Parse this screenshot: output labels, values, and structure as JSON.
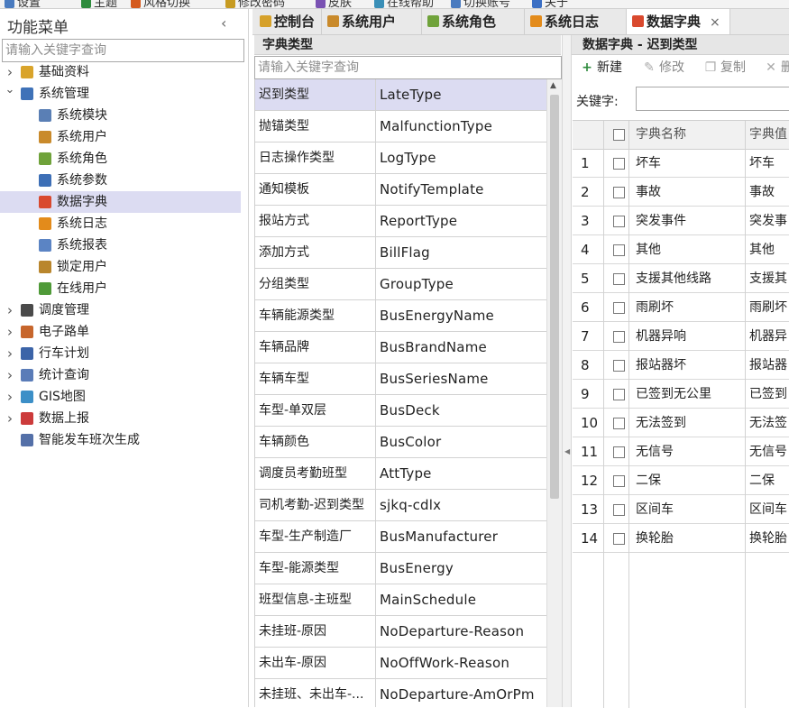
{
  "topbar": {
    "items": [
      "设置",
      "主题",
      "风格切换",
      "修改密码",
      "皮肤",
      "在线帮助",
      "切换账号",
      "关于"
    ]
  },
  "sidebar": {
    "title": "功能菜单",
    "collapse_glyph": "‹",
    "search_placeholder": "请输入关键字查询",
    "items": [
      {
        "label": "基础资料",
        "level": 0,
        "expanded": false,
        "icon": "box-icon"
      },
      {
        "label": "系统管理",
        "level": 0,
        "expanded": true,
        "icon": "tools-icon"
      },
      {
        "label": "系统模块",
        "level": 1,
        "icon": "module-icon"
      },
      {
        "label": "系统用户",
        "level": 1,
        "icon": "user-icon"
      },
      {
        "label": "系统角色",
        "level": 1,
        "icon": "group-icon"
      },
      {
        "label": "系统参数",
        "level": 1,
        "icon": "gear-icon"
      },
      {
        "label": "数据字典",
        "level": 1,
        "icon": "dictionary-icon",
        "selected": true
      },
      {
        "label": "系统日志",
        "level": 1,
        "icon": "log-icon"
      },
      {
        "label": "系统报表",
        "level": 1,
        "icon": "report-icon"
      },
      {
        "label": "锁定用户",
        "level": 1,
        "icon": "lock-user-icon"
      },
      {
        "label": "在线用户",
        "level": 1,
        "icon": "online-user-icon"
      },
      {
        "label": "调度管理",
        "level": 0,
        "expanded": false,
        "icon": "monitor-icon"
      },
      {
        "label": "电子路单",
        "level": 0,
        "expanded": false,
        "icon": "clipboard-icon"
      },
      {
        "label": "行车计划",
        "level": 0,
        "expanded": false,
        "icon": "plan-icon"
      },
      {
        "label": "统计查询",
        "level": 0,
        "expanded": false,
        "icon": "stats-icon"
      },
      {
        "label": "GIS地图",
        "level": 0,
        "expanded": false,
        "icon": "map-icon"
      },
      {
        "label": "数据上报",
        "level": 0,
        "expanded": false,
        "icon": "upload-chart-icon"
      },
      {
        "label": "智能发车班次生成",
        "level": 0,
        "icon": "schedule-icon"
      }
    ]
  },
  "tabs": [
    {
      "label": "控制台",
      "icon": "home-icon"
    },
    {
      "label": "系统用户",
      "icon": "user-icon"
    },
    {
      "label": "系统角色",
      "icon": "group-icon"
    },
    {
      "label": "系统日志",
      "icon": "log-icon"
    },
    {
      "label": "数据字典",
      "icon": "dictionary-icon",
      "active": true,
      "close": "×"
    }
  ],
  "dict_types": {
    "title": "字典类型",
    "search_placeholder": "请输入关键字查询",
    "rows": [
      {
        "name": "迟到类型",
        "code": "LateType",
        "selected": true
      },
      {
        "name": "抛锚类型",
        "code": "MalfunctionType"
      },
      {
        "name": "日志操作类型",
        "code": "LogType"
      },
      {
        "name": "通知模板",
        "code": "NotifyTemplate"
      },
      {
        "name": "报站方式",
        "code": "ReportType"
      },
      {
        "name": "添加方式",
        "code": "BillFlag"
      },
      {
        "name": "分组类型",
        "code": "GroupType"
      },
      {
        "name": "车辆能源类型",
        "code": "BusEnergyName"
      },
      {
        "name": "车辆品牌",
        "code": "BusBrandName"
      },
      {
        "name": "车辆车型",
        "code": "BusSeriesName"
      },
      {
        "name": "车型-单双层",
        "code": "BusDeck"
      },
      {
        "name": "车辆颜色",
        "code": "BusColor"
      },
      {
        "name": "调度员考勤班型",
        "code": "AttType"
      },
      {
        "name": "司机考勤-迟到类型",
        "code": "sjkq-cdlx"
      },
      {
        "name": "车型-生产制造厂",
        "code": "BusManufacturer"
      },
      {
        "name": "车型-能源类型",
        "code": "BusEnergy"
      },
      {
        "name": "班型信息-主班型",
        "code": "MainSchedule"
      },
      {
        "name": "未挂班-原因",
        "code": "NoDeparture-Reason"
      },
      {
        "name": "未出车-原因",
        "code": "NoOffWork-Reason"
      },
      {
        "name": "未挂班、未出车-...",
        "code": "NoDeparture-AmOrPm"
      }
    ]
  },
  "dict_detail": {
    "title": "数据字典 - 迟到类型",
    "toolbar": {
      "new": "新建",
      "edit": "修改",
      "copy": "复制",
      "delete": "删"
    },
    "keyword_label": "关键字:",
    "columns": {
      "name": "字典名称",
      "value": "字典值"
    },
    "rows": [
      {
        "num": "1",
        "name": "坏车",
        "value": "坏车"
      },
      {
        "num": "2",
        "name": "事故",
        "value": "事故"
      },
      {
        "num": "3",
        "name": "突发事件",
        "value": "突发事"
      },
      {
        "num": "4",
        "name": "其他",
        "value": "其他"
      },
      {
        "num": "5",
        "name": "支援其他线路",
        "value": "支援其"
      },
      {
        "num": "6",
        "name": "雨刷坏",
        "value": "雨刷坏"
      },
      {
        "num": "7",
        "name": "机器异响",
        "value": "机器异"
      },
      {
        "num": "8",
        "name": "报站器坏",
        "value": "报站器"
      },
      {
        "num": "9",
        "name": "已签到无公里",
        "value": "已签到"
      },
      {
        "num": "10",
        "name": "无法签到",
        "value": "无法签"
      },
      {
        "num": "11",
        "name": "无信号",
        "value": "无信号"
      },
      {
        "num": "12",
        "name": "二保",
        "value": "二保"
      },
      {
        "num": "13",
        "name": "区间车",
        "value": "区间车"
      },
      {
        "num": "14",
        "name": "换轮胎",
        "value": "换轮胎"
      }
    ]
  },
  "colors": {
    "selected_bg": "#dcdcf2",
    "accent_green": "#2e8b3d",
    "header_bg": "#e6e6e6"
  }
}
